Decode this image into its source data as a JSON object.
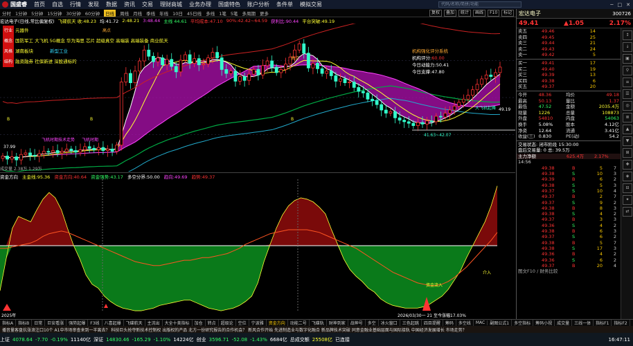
{
  "app": {
    "logo": "国盛睿",
    "menu": [
      "首页",
      "自选",
      "行情",
      "发现",
      "数据",
      "资讯",
      "交易",
      "理财商城",
      "业务办理",
      "国盛特色",
      "账户分析",
      "条件单",
      "模拟交易"
    ],
    "search_placeholder": "代码/名称/简拼/功能",
    "win": [
      "─",
      "□",
      "✕"
    ]
  },
  "periods": [
    "分时",
    "1分钟",
    "5分钟",
    "15分钟",
    "30分钟",
    "60分钟",
    "日线",
    "周线",
    "月线",
    "季线",
    "年线",
    "10日",
    "45日线",
    "多线",
    "1笔",
    "5笔",
    "多周期",
    "更多"
  ],
  "active_period": "日线",
  "tools": [
    "复权",
    "叠加",
    "统计",
    "画线",
    "F10",
    "标记",
    "+自选",
    "◁",
    "▷"
  ],
  "title_items": [
    {
      "t": "宏达电子(日线,常比偏复权)",
      "c": "t-w"
    },
    {
      "t": "飞碟航天 收:48.23",
      "c": "t-y"
    },
    {
      "t": "均:41.72",
      "c": "t-w"
    },
    {
      "t": "2:48.21",
      "c": "t-y"
    },
    {
      "t": "3:48.44",
      "c": "t-m"
    },
    {
      "t": "主线 44.61",
      "c": "t-g"
    },
    {
      "t": "平均成本:47.10",
      "c": "t-r"
    },
    {
      "t": "90%:42.42~64.59",
      "c": "t-r"
    },
    {
      "t": "获利比:90.44",
      "c": "t-m"
    },
    {
      "t": "平台突破:49.19",
      "c": "t-y"
    }
  ],
  "concepts": [
    {
      "badge": "行业",
      "text": "元器件",
      "c": "t-y"
    },
    {
      "badge": "概念",
      "text": "国防军工 大飞机 5G概念 华为海思 芯片 超级真空 高端装 高端装备 商业航天",
      "c": "t-y"
    },
    {
      "badge": "风格",
      "text": "湖南板块",
      "extra": "新型工业",
      "c": "t-y"
    },
    {
      "badge": "结构",
      "text": "融资融券 社保新进 深股通标的",
      "c": "t-y"
    }
  ],
  "rating": {
    "title": "机构强化评分系统",
    "rows": [
      {
        "k": "机构评分:",
        "v": "60.00",
        "c": "t-r"
      },
      {
        "k": "今日动能力:",
        "v": "50.41",
        "c": "t-w"
      },
      {
        "k": "今日支撑:",
        "v": "47.80",
        "c": "t-w"
      }
    ]
  },
  "main_annotations": {
    "high_label": "高点",
    "b_marks": [
      "B",
      "B",
      "B"
    ],
    "low_label": "1.96",
    "range_label": "41.63~42.07",
    "left_price": "37.99",
    "right_price": "49.19",
    "buy_label": "大飞机起舞",
    "left_text": "飞机时期技术走势",
    "mid_text": "飞机时期"
  },
  "volume_info": "成交量  2.38万  1.29万",
  "sub_header": [
    {
      "t": "资金方向",
      "c": "t-w"
    },
    {
      "t": "主金线:95.36",
      "c": "t-y"
    },
    {
      "t": "资金方向:40.64",
      "c": "t-r"
    },
    {
      "t": "资金强势:43.17",
      "c": "t-g"
    },
    {
      "t": "多空分界:50.00",
      "c": "t-w"
    },
    {
      "t": "趋向:49.69",
      "c": "t-m"
    },
    {
      "t": "趋势:49.37",
      "c": "t-r"
    }
  ],
  "sub_annotations": {
    "date_label": "2026/03/30一 21 至今涨幅17.03%",
    "sell_label": "资金流入",
    "buy_label": "介入",
    "left_label": "2025年",
    "sell_top": "卖出"
  },
  "tabs": [
    "指标A",
    "指标B",
    "日常",
    "巨安看涨",
    "强势起爆",
    "F3线",
    "八喜起爆",
    "飞碟航天",
    "主流出",
    "大全十美指标",
    "加仓",
    "转点",
    "超级论",
    "空位",
    "宁波雅",
    "资金方向",
    "动能二号",
    "飞碟轨",
    "财神到家",
    "战神号",
    "多空",
    "冰火窗口",
    "三色起跳",
    "四目提醒",
    "筹码",
    "多空线",
    "MAC",
    "副图公式1",
    "多空指标",
    "筹码小视",
    "成交量",
    "三线一体",
    "指标F1",
    "指标F2"
  ],
  "active_tab": "资金方向",
  "news": "播音量客盘抗涨浪注口10个   A1中市场审查来到一半离去？   科技巨头抢夺新技术控制权   出版权的产品   北方一份研究报告的合作机会？   新风合作开始   先进制造业与数字化融合   新品牌技术突破   同意金融业基础层面与国际接轨   中国经济发展增长   市场走势？",
  "status": [
    {
      "t": "上证",
      "c": "t-w"
    },
    {
      "t": "4078.64",
      "c": "t-g"
    },
    {
      "t": "-7.70",
      "c": "t-g"
    },
    {
      "t": "-0.19%",
      "c": "t-g"
    },
    {
      "t": "11140亿",
      "c": "t-w"
    },
    {
      "t": "深证",
      "c": "t-w"
    },
    {
      "t": "14830.46",
      "c": "t-g"
    },
    {
      "t": "-165.29",
      "c": "t-g"
    },
    {
      "t": "-1.10%",
      "c": "t-g"
    },
    {
      "t": "14224亿",
      "c": "t-w"
    },
    {
      "t": "创业",
      "c": "t-w"
    },
    {
      "t": "3596.71",
      "c": "t-g"
    },
    {
      "t": "-52.08",
      "c": "t-g"
    },
    {
      "t": "-1.43%",
      "c": "t-g"
    },
    {
      "t": "6684亿",
      "c": "t-w"
    },
    {
      "t": "总成交额",
      "c": "t-w"
    },
    {
      "t": "25508亿",
      "c": "t-y"
    },
    {
      "t": "已连接",
      "c": "t-w"
    }
  ],
  "status_time": "16:47:11",
  "right": {
    "name": "宏达电子",
    "code": "300726",
    "price": "49.41",
    "change": "▲1.05",
    "pct": "2.17%",
    "sells": [
      {
        "k": "卖五",
        "p": "49.46",
        "v": "14"
      },
      {
        "k": "卖四",
        "p": "49.45",
        "v": "25"
      },
      {
        "k": "卖三",
        "p": "49.44",
        "v": "21"
      },
      {
        "k": "卖二",
        "p": "49.43",
        "v": "24"
      },
      {
        "k": "卖一",
        "p": "49.42",
        "v": "5"
      }
    ],
    "buys": [
      {
        "k": "买一",
        "p": "49.41",
        "v": "17"
      },
      {
        "k": "买二",
        "p": "49.40",
        "v": "19"
      },
      {
        "k": "买三",
        "p": "49.39",
        "v": "13"
      },
      {
        "k": "买四",
        "p": "49.38",
        "v": "6"
      },
      {
        "k": "买五",
        "p": "49.37",
        "v": "20"
      }
    ],
    "stats": [
      {
        "a": "今开",
        "b": "48.36",
        "bc": "t-r",
        "c": "均价",
        "d": "49.18",
        "dc": "t-r"
      },
      {
        "a": "最高",
        "b": "50.13",
        "bc": "t-r",
        "c": "量比",
        "d": "1.37",
        "dc": "t-r"
      },
      {
        "a": "最低",
        "b": "47.52",
        "bc": "t-g",
        "c": "金额",
        "d": "2035.4万",
        "dc": "t-y"
      },
      {
        "a": "现量",
        "b": "1226",
        "bc": "t-y",
        "c": "总量",
        "d": "108873",
        "dc": "t-y"
      },
      {
        "a": "外盘",
        "b": "54810",
        "bc": "t-r",
        "c": "内盘",
        "d": "54063",
        "dc": "t-g"
      },
      {
        "a": "换手",
        "b": "5.08%",
        "bc": "t-w",
        "c": "股本",
        "d": "4.12亿",
        "dc": "t-w"
      },
      {
        "a": "净资",
        "b": "12.64",
        "bc": "t-w",
        "c": "流通",
        "d": "3.41亿",
        "dc": "t-w"
      },
      {
        "a": "收益(三)",
        "b": "0.830",
        "bc": "t-w",
        "c": "PE(动)",
        "d": "54.2",
        "dc": "t-w"
      }
    ],
    "trade_status": "交易状态: 闭市阶段  15:30:00",
    "after_hours": "盘后交易量: 0   总: 39.5万",
    "main_flow": "主力净额",
    "main_flow_val": "625.4万",
    "main_flow_pct": "2.17%",
    "ticks_label": "14:56",
    "ticks": [
      [
        "49.38",
        "B",
        "5",
        "7"
      ],
      [
        "49.38",
        "S",
        "10",
        "3"
      ],
      [
        "49.39",
        "B",
        "6",
        "2"
      ],
      [
        "49.38",
        "S",
        "5",
        "3"
      ],
      [
        "49.37",
        "S",
        "10",
        "4"
      ],
      [
        "49.37",
        "B",
        "2",
        "7"
      ],
      [
        "49.37",
        "S",
        "9",
        "2"
      ],
      [
        "49.38",
        "B",
        "8",
        "3"
      ],
      [
        "49.38",
        "S",
        "4",
        "2"
      ],
      [
        "49.37",
        "B",
        "3",
        "3"
      ],
      [
        "49.36",
        "S",
        "4",
        "2"
      ],
      [
        "49.38",
        "B",
        "6",
        "3"
      ],
      [
        "49.37",
        "S",
        "6",
        "2"
      ],
      [
        "49.38",
        "B",
        "5",
        "7"
      ],
      [
        "49.38",
        "S",
        "17",
        "3"
      ],
      [
        "49.36",
        "B",
        "4",
        "2"
      ],
      [
        "49.36",
        "S",
        "6",
        "2"
      ],
      [
        "49.37",
        "B",
        "20",
        "4"
      ],
      [
        "49.38",
        "S",
        "4",
        "6"
      ],
      [
        "49.38",
        "B",
        "6",
        "2"
      ],
      [
        "49.37",
        "S",
        "5",
        "3"
      ],
      [
        "49.38",
        "B",
        "4",
        "2"
      ],
      [
        "49.37",
        "S",
        "7",
        "3"
      ],
      [
        "49.36",
        "B",
        "3",
        "2"
      ],
      [
        "49.36",
        "S",
        "5",
        "2"
      ],
      [
        "49.37",
        "B",
        "6",
        "3"
      ],
      [
        "49.37",
        "S",
        "4",
        "2"
      ],
      [
        "49.38",
        "B",
        "5",
        "3"
      ],
      [
        "49.39",
        "S",
        "4",
        "2"
      ],
      [
        "49.39",
        "B",
        "6",
        "3"
      ],
      [
        "49.40",
        "S",
        "5",
        "2"
      ],
      [
        "49.40",
        "B",
        "4",
        "3"
      ]
    ],
    "ticks_tail_time": "14:57",
    "ticks_tail": [
      [
        "49.38",
        "S",
        "10",
        "9"
      ],
      [
        "49.37",
        "B",
        "122",
        "3"
      ],
      [
        "49.37",
        "S",
        "8",
        "2"
      ],
      [
        "49.39",
        "B",
        "6",
        "3"
      ],
      [
        "49.40",
        "S",
        "7",
        "2"
      ],
      [
        "49.41",
        "B",
        "1226",
        "129"
      ]
    ],
    "tail_time": "15:00",
    "bottom_label": "图文F10 / 财务比较"
  },
  "side_icons": [
    "↕",
    "↓",
    "▣",
    "⚲",
    "≡",
    "☰",
    "◎",
    "≣",
    "▲",
    "▼",
    "⊞",
    "✚",
    "◈",
    "⊟",
    "✦",
    "⇄"
  ],
  "colors": {
    "up": "#ff3333",
    "down": "#33ff66",
    "warn": "#ffff33",
    "bg": "#000000"
  },
  "chart_data": [
    {
      "type": "candlestick",
      "title": "宏达电子(日线,常比偏复权)",
      "series": [
        {
          "name": "飞碟航天",
          "values": [
            38,
            37.6,
            37.9,
            37.5,
            38.2,
            38.4,
            38.1,
            38.0,
            38.3,
            38.6,
            38.5,
            38.7,
            38.4,
            38.6,
            38.9,
            38.7,
            38.5,
            38.8,
            39.2,
            39.0,
            38.8,
            39.1,
            38.7,
            38.9,
            38.6,
            39.4,
            47.5,
            48.6,
            47.4,
            48.9,
            50.2,
            51.6,
            50.8,
            50.1,
            50.6,
            49.7,
            50.4,
            49.5,
            48.8,
            50.3,
            51.0,
            49.9,
            50.5,
            49.7,
            49.8,
            50.6,
            51.3,
            50.6,
            49.1,
            48.6,
            48.9,
            47.6,
            48.2,
            47.7,
            48.5,
            49.1,
            48.4,
            49.6,
            50.2,
            49.4,
            48.7,
            49.1,
            49.8,
            50.7,
            51.6,
            52.4,
            51.2,
            49.3,
            49.9,
            49.2,
            48.6,
            48.9,
            48.3,
            47.6,
            47.9,
            47.4,
            47.5,
            46.8,
            46.3,
            46.1,
            45.3,
            45.1,
            44.6,
            43.9,
            43.5,
            43.7,
            42.9,
            42.6,
            42.4,
            42.2,
            41.9,
            42.3,
            42.1,
            42.5,
            42.4,
            43.1,
            43.0,
            43.5,
            43.9,
            44.4,
            44.9,
            45.3,
            45.8,
            46.5,
            47.2,
            47.9,
            48.4,
            48.2,
            48.7,
            49.41
          ]
        }
      ],
      "ylim": [
        36,
        55
      ]
    },
    {
      "type": "area",
      "title": "资金方向",
      "series": [
        {
          "name": "主金线",
          "values": [
            16,
            40,
            63,
            72,
            70,
            68,
            77,
            85,
            90,
            86,
            77,
            63,
            50,
            40,
            28,
            21,
            18,
            12,
            8,
            5,
            3,
            2,
            1,
            1,
            2,
            3,
            5,
            6,
            7,
            8,
            9,
            9,
            7,
            5,
            3,
            2,
            1,
            2,
            3,
            5,
            8,
            12,
            22,
            38,
            51,
            63,
            73,
            80,
            84,
            86,
            85,
            83,
            79,
            74,
            62,
            51,
            40,
            32,
            27,
            23,
            18,
            15,
            10,
            7,
            5,
            4,
            3,
            3,
            3,
            4,
            6,
            9,
            12,
            17,
            24,
            31,
            41,
            50,
            59,
            68,
            80,
            95
          ]
        },
        {
          "name": "趋势",
          "values": [
            48,
            48,
            49,
            50,
            51,
            52,
            54,
            57,
            59,
            60,
            61,
            60,
            58,
            56,
            54,
            52,
            50,
            48,
            46,
            44,
            42,
            40,
            38,
            37,
            36,
            35,
            35,
            36,
            37,
            38,
            39,
            39,
            40,
            41,
            41,
            42,
            43,
            44,
            46,
            48,
            51,
            53,
            55,
            57,
            59,
            60,
            61,
            62,
            62,
            62,
            62,
            61,
            60,
            58,
            56,
            54,
            52,
            50,
            48,
            45,
            42,
            39,
            36,
            33,
            30,
            28,
            26,
            24,
            22,
            21,
            20,
            20,
            21,
            23,
            26,
            30,
            34,
            39,
            44,
            49,
            54,
            60
          ]
        }
      ],
      "ylim": [
        0,
        100
      ]
    }
  ]
}
